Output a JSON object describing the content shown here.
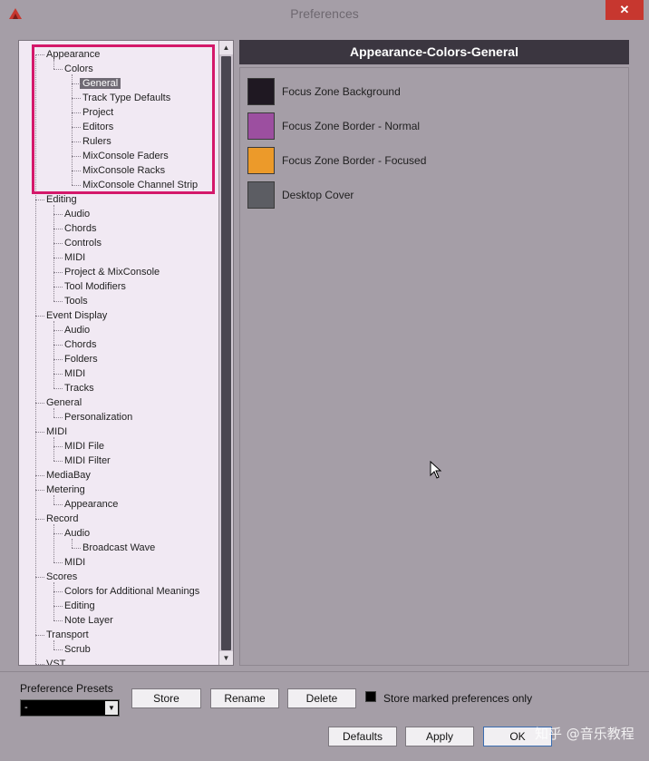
{
  "window": {
    "title": "Preferences",
    "close_glyph": "✕",
    "app_icon": "cubase-logo-icon",
    "close_icon": "close-icon"
  },
  "tree": {
    "items": [
      {
        "label": "Appearance",
        "depth": 0
      },
      {
        "label": "Colors",
        "depth": 1
      },
      {
        "label": "General",
        "depth": 2,
        "selected": true
      },
      {
        "label": "Track Type Defaults",
        "depth": 2
      },
      {
        "label": "Project",
        "depth": 2
      },
      {
        "label": "Editors",
        "depth": 2
      },
      {
        "label": "Rulers",
        "depth": 2
      },
      {
        "label": "MixConsole Faders",
        "depth": 2
      },
      {
        "label": "MixConsole Racks",
        "depth": 2
      },
      {
        "label": "MixConsole Channel Strip",
        "depth": 2
      },
      {
        "label": "Editing",
        "depth": 0
      },
      {
        "label": "Audio",
        "depth": 1
      },
      {
        "label": "Chords",
        "depth": 1
      },
      {
        "label": "Controls",
        "depth": 1
      },
      {
        "label": "MIDI",
        "depth": 1
      },
      {
        "label": "Project & MixConsole",
        "depth": 1
      },
      {
        "label": "Tool Modifiers",
        "depth": 1
      },
      {
        "label": "Tools",
        "depth": 1
      },
      {
        "label": "Event Display",
        "depth": 0
      },
      {
        "label": "Audio",
        "depth": 1
      },
      {
        "label": "Chords",
        "depth": 1
      },
      {
        "label": "Folders",
        "depth": 1
      },
      {
        "label": "MIDI",
        "depth": 1
      },
      {
        "label": "Tracks",
        "depth": 1
      },
      {
        "label": "General",
        "depth": 0
      },
      {
        "label": "Personalization",
        "depth": 1
      },
      {
        "label": "MIDI",
        "depth": 0
      },
      {
        "label": "MIDI File",
        "depth": 1
      },
      {
        "label": "MIDI Filter",
        "depth": 1
      },
      {
        "label": "MediaBay",
        "depth": 0
      },
      {
        "label": "Metering",
        "depth": 0
      },
      {
        "label": "Appearance",
        "depth": 1
      },
      {
        "label": "Record",
        "depth": 0
      },
      {
        "label": "Audio",
        "depth": 1
      },
      {
        "label": "Broadcast Wave",
        "depth": 2
      },
      {
        "label": "MIDI",
        "depth": 1
      },
      {
        "label": "Scores",
        "depth": 0
      },
      {
        "label": "Colors for Additional Meanings",
        "depth": 1
      },
      {
        "label": "Editing",
        "depth": 1
      },
      {
        "label": "Note Layer",
        "depth": 1
      },
      {
        "label": "Transport",
        "depth": 0
      },
      {
        "label": "Scrub",
        "depth": 1
      },
      {
        "label": "VST",
        "depth": 0
      }
    ],
    "scroll_up_glyph": "▲",
    "scroll_down_glyph": "▼"
  },
  "section": {
    "title": "Appearance-Colors-General"
  },
  "colors": [
    {
      "label": "Focus Zone Background",
      "color": "#1f1822"
    },
    {
      "label": "Focus Zone Border - Normal",
      "color": "#9c4fa0"
    },
    {
      "label": "Focus Zone Border - Focused",
      "color": "#ec9a2a"
    },
    {
      "label": "Desktop Cover",
      "color": "#5c5d63"
    }
  ],
  "presets": {
    "label": "Preference Presets",
    "selected": "-",
    "arrow_glyph": "▼",
    "store_label": "Store",
    "rename_label": "Rename",
    "delete_label": "Delete",
    "store_marked_label": "Store marked preferences only",
    "store_marked_checked": true
  },
  "footer": {
    "defaults_label": "Defaults",
    "apply_label": "Apply",
    "ok_label": "OK"
  },
  "watermark": "知乎 @音乐教程",
  "theme": {
    "highlight_box_color": "#d4186a",
    "selected_bg": "#6f6a74",
    "header_bg": "#3b3640"
  }
}
